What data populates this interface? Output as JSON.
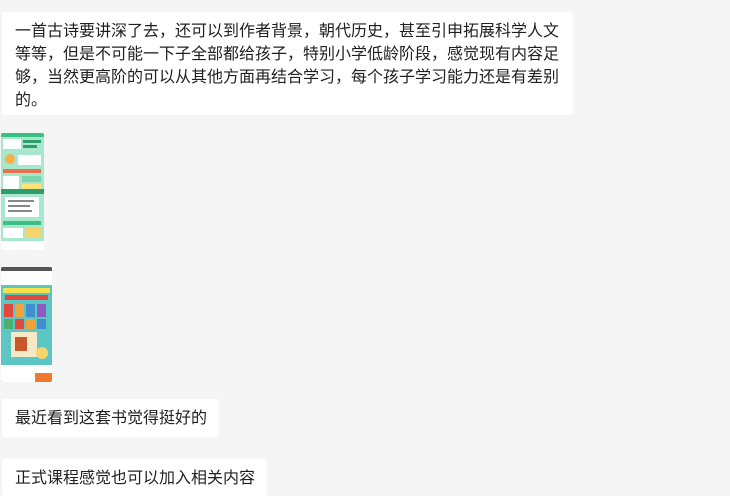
{
  "messages": [
    {
      "text": "一首古诗要讲深了去，还可以到作者背景，朝代历史，甚至引申拓展科学人文等等，但是不可能一下子全部都给孩子，特别小学低龄阶段，感觉现有内容足够，当然更高阶的可以从其他方面再结合学习，每个孩子学习能力还是有差别的。"
    },
    {
      "image": "book-page-screenshot-green"
    },
    {
      "image": "book-promo-screenshot-teal"
    },
    {
      "text": "最近看到这套书觉得挺好的"
    },
    {
      "text": "正式课程感觉也可以加入相关内容"
    }
  ],
  "colors": {
    "background": "#f5f5f5",
    "bubble": "#ffffff",
    "text": "#1f1f1f"
  }
}
